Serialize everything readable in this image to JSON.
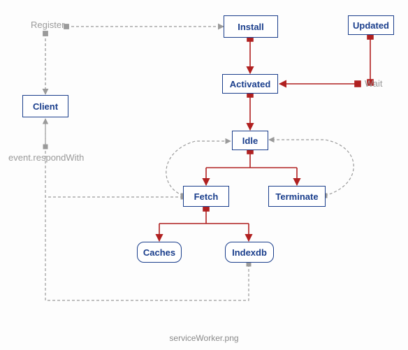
{
  "caption": "serviceWorker.png",
  "labels": {
    "register": "Register",
    "wait": "Wait",
    "respond": "event.respondWith"
  },
  "nodes": {
    "install": {
      "text": "Install"
    },
    "updated": {
      "text": "Updated"
    },
    "activated": {
      "text": "Activated"
    },
    "client": {
      "text": "Client"
    },
    "idle": {
      "text": "Idle"
    },
    "fetch": {
      "text": "Fetch"
    },
    "terminate": {
      "text": "Terminate"
    },
    "caches": {
      "text": "Caches"
    },
    "indexdb": {
      "text": "Indexdb"
    }
  },
  "edges_solid": [
    {
      "from": "install",
      "to": "activated",
      "color": "red"
    },
    {
      "from": "updated",
      "to": "wait",
      "color": "red"
    },
    {
      "from": "wait",
      "to": "activated",
      "color": "red"
    },
    {
      "from": "activated",
      "to": "idle",
      "color": "red"
    },
    {
      "from": "idle",
      "to": "fetch",
      "color": "red",
      "via": "fork"
    },
    {
      "from": "idle",
      "to": "terminate",
      "color": "red",
      "via": "fork"
    },
    {
      "from": "fetch",
      "to": "caches",
      "color": "red",
      "via": "fork"
    },
    {
      "from": "fetch",
      "to": "indexdb",
      "color": "red",
      "via": "fork"
    }
  ],
  "edges_dashed": [
    {
      "from": "register",
      "to": "install"
    },
    {
      "from": "register",
      "to": "client",
      "note": "down"
    },
    {
      "from": "terminate",
      "to": "idle",
      "note": "loop-right"
    },
    {
      "from": "fetch",
      "to": "idle",
      "note": "loop-left"
    },
    {
      "from": "fetch",
      "to": "respond",
      "note": "left"
    },
    {
      "from": "indexdb",
      "to": "respond",
      "note": "down-left"
    },
    {
      "from": "respond",
      "to": "client",
      "note": "up"
    }
  ]
}
